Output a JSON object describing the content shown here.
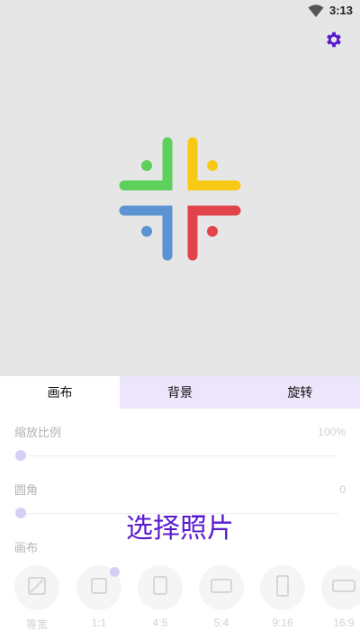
{
  "status_bar": {
    "time": "3:13"
  },
  "tabs": [
    {
      "label": "画布"
    },
    {
      "label": "背景"
    },
    {
      "label": "旋转"
    }
  ],
  "canvas_settings": {
    "scale_label": "缩放比例",
    "scale_value": "100%",
    "corner_label": "圆角",
    "corner_value": "0",
    "canvas_label": "画布"
  },
  "choose_photo_label": "选择照片",
  "ratios": [
    {
      "label": "等宽",
      "icon": "no-ratio-icon",
      "selected": false
    },
    {
      "label": "1:1",
      "icon": "square-icon",
      "selected": true
    },
    {
      "label": "4:5",
      "icon": "portrait-rect-icon",
      "selected": false
    },
    {
      "label": "5:4",
      "icon": "landscape-rect-icon",
      "selected": false
    },
    {
      "label": "9:16",
      "icon": "tall-rect-icon",
      "selected": false
    },
    {
      "label": "16:9",
      "icon": "wide-rect-icon",
      "selected": false
    }
  ],
  "colors": {
    "accent": "#5a1bd0",
    "tab_inactive_bg": "#ece5fb",
    "logo_green": "#5cd05a",
    "logo_yellow": "#f7c915",
    "logo_blue": "#5b93d3",
    "logo_red": "#e0434a"
  }
}
